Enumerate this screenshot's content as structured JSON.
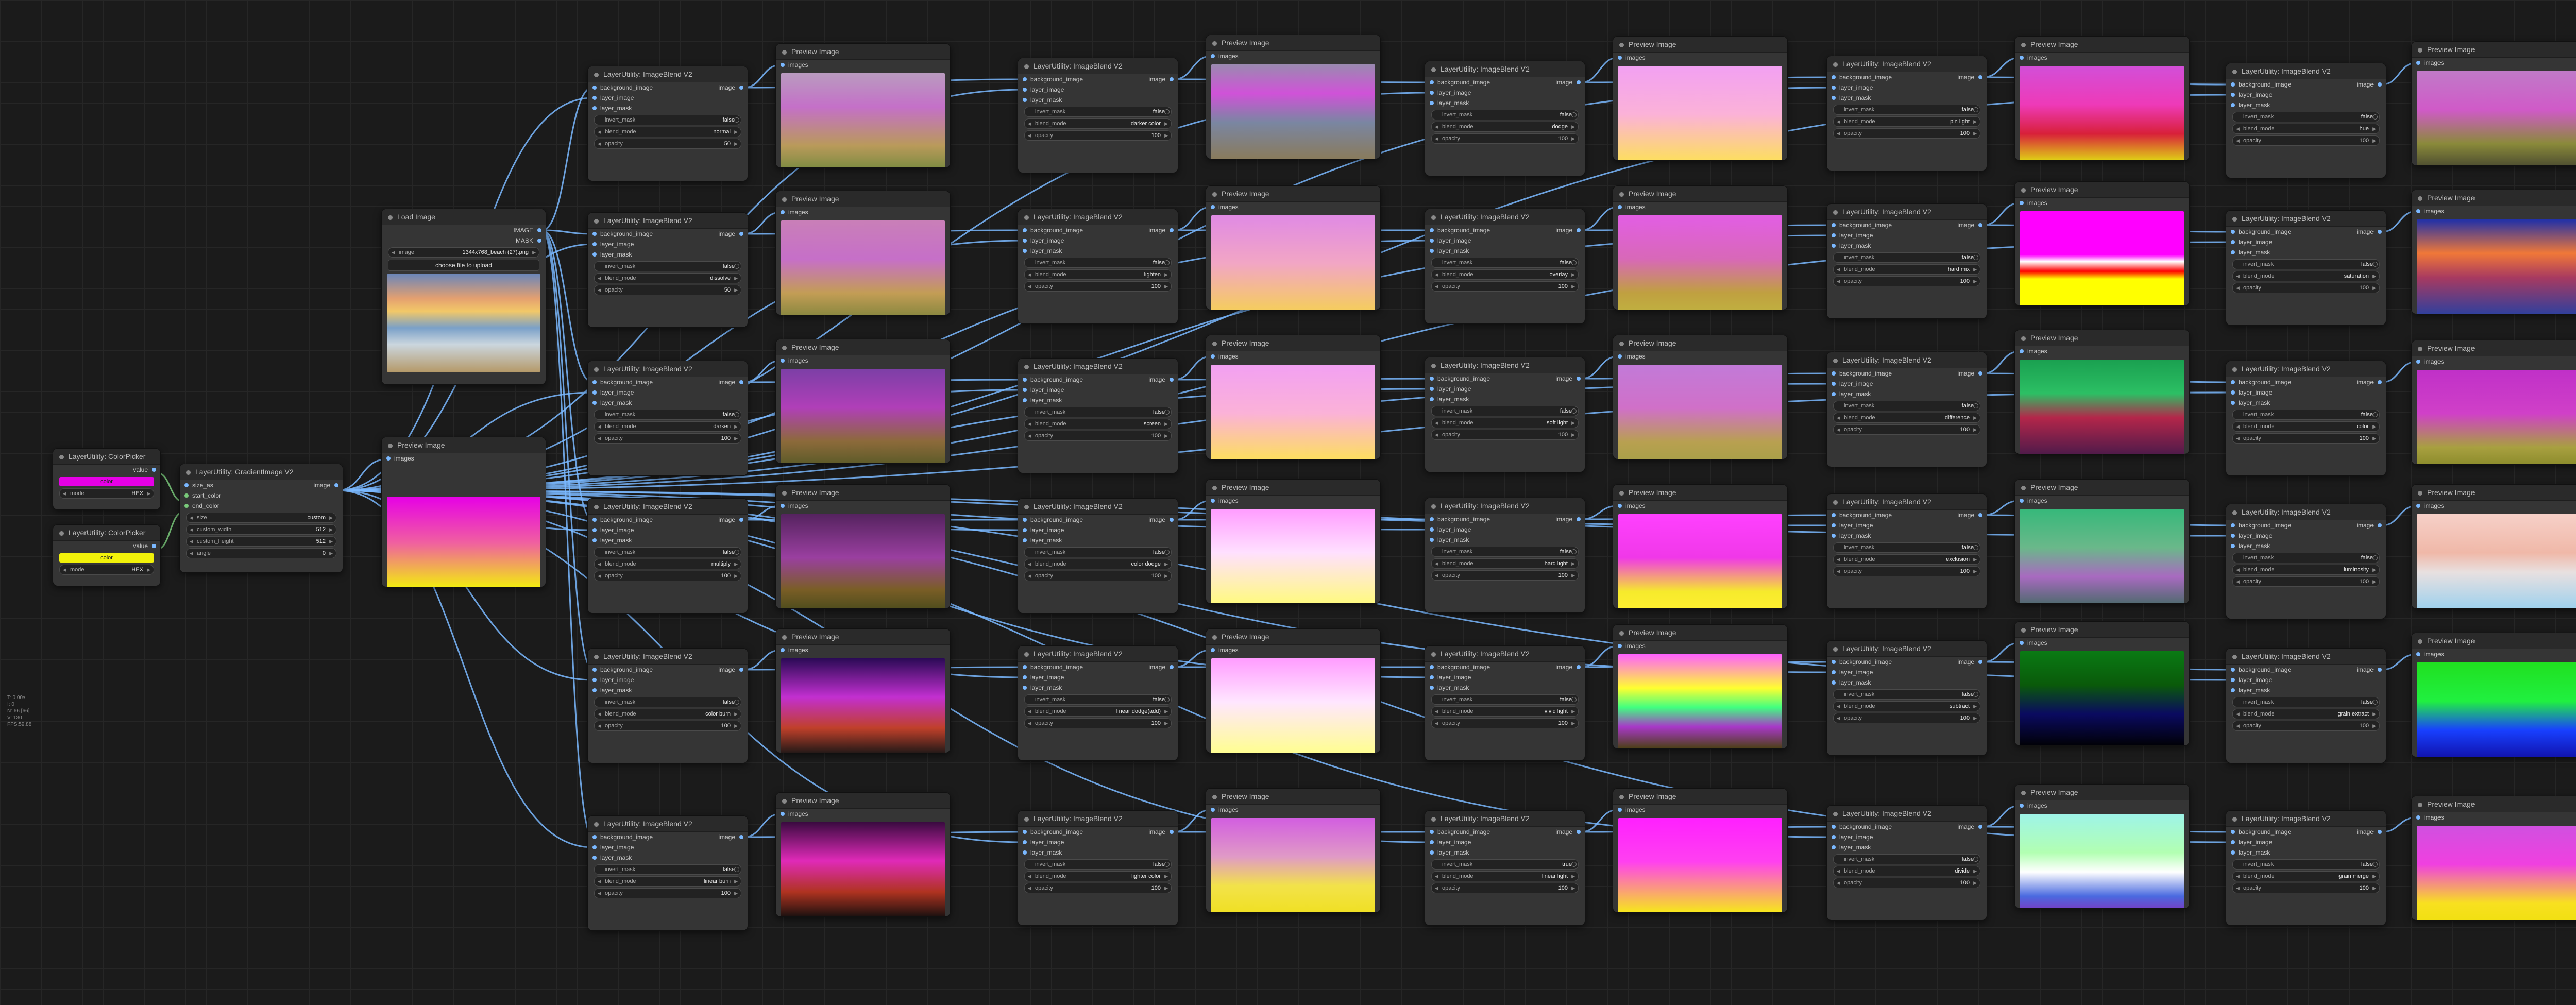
{
  "colorpickers": [
    {
      "title": "LayerUtility: ColorPicker",
      "output": "value",
      "color_label": "color",
      "color_hex": "#e600e6",
      "mode_label": "mode",
      "mode_value": "HEX"
    },
    {
      "title": "LayerUtility: ColorPicker",
      "output": "value",
      "color_label": "color",
      "color_hex": "#f2f20a",
      "mode_label": "mode",
      "mode_value": "HEX"
    }
  ],
  "gradient": {
    "title": "LayerUtility: GradientImage V2",
    "inputs": [
      "size_as",
      "start_color",
      "end_color"
    ],
    "output": "image",
    "widgets": [
      {
        "label": "size",
        "value": "custom"
      },
      {
        "label": "custom_width",
        "value": "512"
      },
      {
        "label": "custom_height",
        "value": "512"
      },
      {
        "label": "angle",
        "value": "0"
      }
    ]
  },
  "loadimage": {
    "title": "Load Image",
    "outputs": [
      "IMAGE",
      "MASK"
    ],
    "image_label": "image",
    "image_value": "1344x768_beach (27).png",
    "upload_label": "choose file to upload"
  },
  "preview_title": "Preview Image",
  "preview_input": "images",
  "blend": {
    "title": "LayerUtility: ImageBlend V2",
    "inputs": [
      "background_image",
      "layer_image",
      "layer_mask"
    ],
    "output": "image",
    "invert_label": "invert_mask",
    "mode_label": "blend_mode",
    "opacity_label": "opacity",
    "opacity_value": "100"
  },
  "blend_columns": [
    [
      {
        "mode": "normal",
        "invert": "false",
        "opacity": "50"
      },
      {
        "mode": "dissolve",
        "invert": "false",
        "opacity": "50"
      },
      {
        "mode": "darken",
        "invert": "false",
        "opacity": "100"
      },
      {
        "mode": "multiply",
        "invert": "false",
        "opacity": "100"
      },
      {
        "mode": "color burn",
        "invert": "false",
        "opacity": "100"
      },
      {
        "mode": "linear burn",
        "invert": "false",
        "opacity": "100"
      }
    ],
    [
      {
        "mode": "darker color",
        "invert": "false",
        "opacity": "100"
      },
      {
        "mode": "lighten",
        "invert": "false",
        "opacity": "100"
      },
      {
        "mode": "screen",
        "invert": "false",
        "opacity": "100"
      },
      {
        "mode": "color dodge",
        "invert": "false",
        "opacity": "100"
      },
      {
        "mode": "linear dodge(add)",
        "invert": "false",
        "opacity": "100"
      },
      {
        "mode": "lighter color",
        "invert": "false",
        "opacity": "100"
      }
    ],
    [
      {
        "mode": "dodge",
        "invert": "false",
        "opacity": "100"
      },
      {
        "mode": "overlay",
        "invert": "false",
        "opacity": "100"
      },
      {
        "mode": "soft light",
        "invert": "false",
        "opacity": "100"
      },
      {
        "mode": "hard light",
        "invert": "false",
        "opacity": "100"
      },
      {
        "mode": "vivid light",
        "invert": "false",
        "opacity": "100"
      },
      {
        "mode": "linear light",
        "invert": "true",
        "opacity": "100"
      }
    ],
    [
      {
        "mode": "pin light",
        "invert": "false",
        "opacity": "100"
      },
      {
        "mode": "hard mix",
        "invert": "false",
        "opacity": "100"
      },
      {
        "mode": "difference",
        "invert": "false",
        "opacity": "100"
      },
      {
        "mode": "exclusion",
        "invert": "false",
        "opacity": "100"
      },
      {
        "mode": "subtract",
        "invert": "false",
        "opacity": "100"
      },
      {
        "mode": "divide",
        "invert": "false",
        "opacity": "100"
      }
    ],
    [
      {
        "mode": "hue",
        "invert": "false",
        "opacity": "100"
      },
      {
        "mode": "saturation",
        "invert": "false",
        "opacity": "100"
      },
      {
        "mode": "color",
        "invert": "false",
        "opacity": "100"
      },
      {
        "mode": "luminosity",
        "invert": "false",
        "opacity": "100"
      },
      {
        "mode": "grain extract",
        "invert": "false",
        "opacity": "100"
      },
      {
        "mode": "grain merge",
        "invert": "false",
        "opacity": "100"
      }
    ]
  ],
  "preview_styles": [
    [
      "normal",
      "dissolve",
      "darken",
      "multiply",
      "burn",
      "burn2"
    ],
    [
      "darkcol",
      "light",
      "screen",
      "cdodge",
      "adddodge",
      "lightcol"
    ],
    [
      "screen",
      "overlay",
      "soft",
      "hard",
      "vivid",
      "lin"
    ],
    [
      "pin",
      "hardmix",
      "diff",
      "excl",
      "sub",
      "div"
    ],
    [
      "hue",
      "sat",
      "col",
      "lum",
      "gext",
      "gmerge"
    ]
  ],
  "info_lines": [
    "T: 0.00s",
    "I: 0",
    "N: 66 [66]",
    "V: 130",
    "FPS:59.88"
  ],
  "colors": {
    "wire": "#7ab8ff",
    "wire_green": "#79c97a",
    "node_bg": "#353535",
    "title_bg": "#2a2a2a",
    "canvas": "#1b1b1b"
  }
}
